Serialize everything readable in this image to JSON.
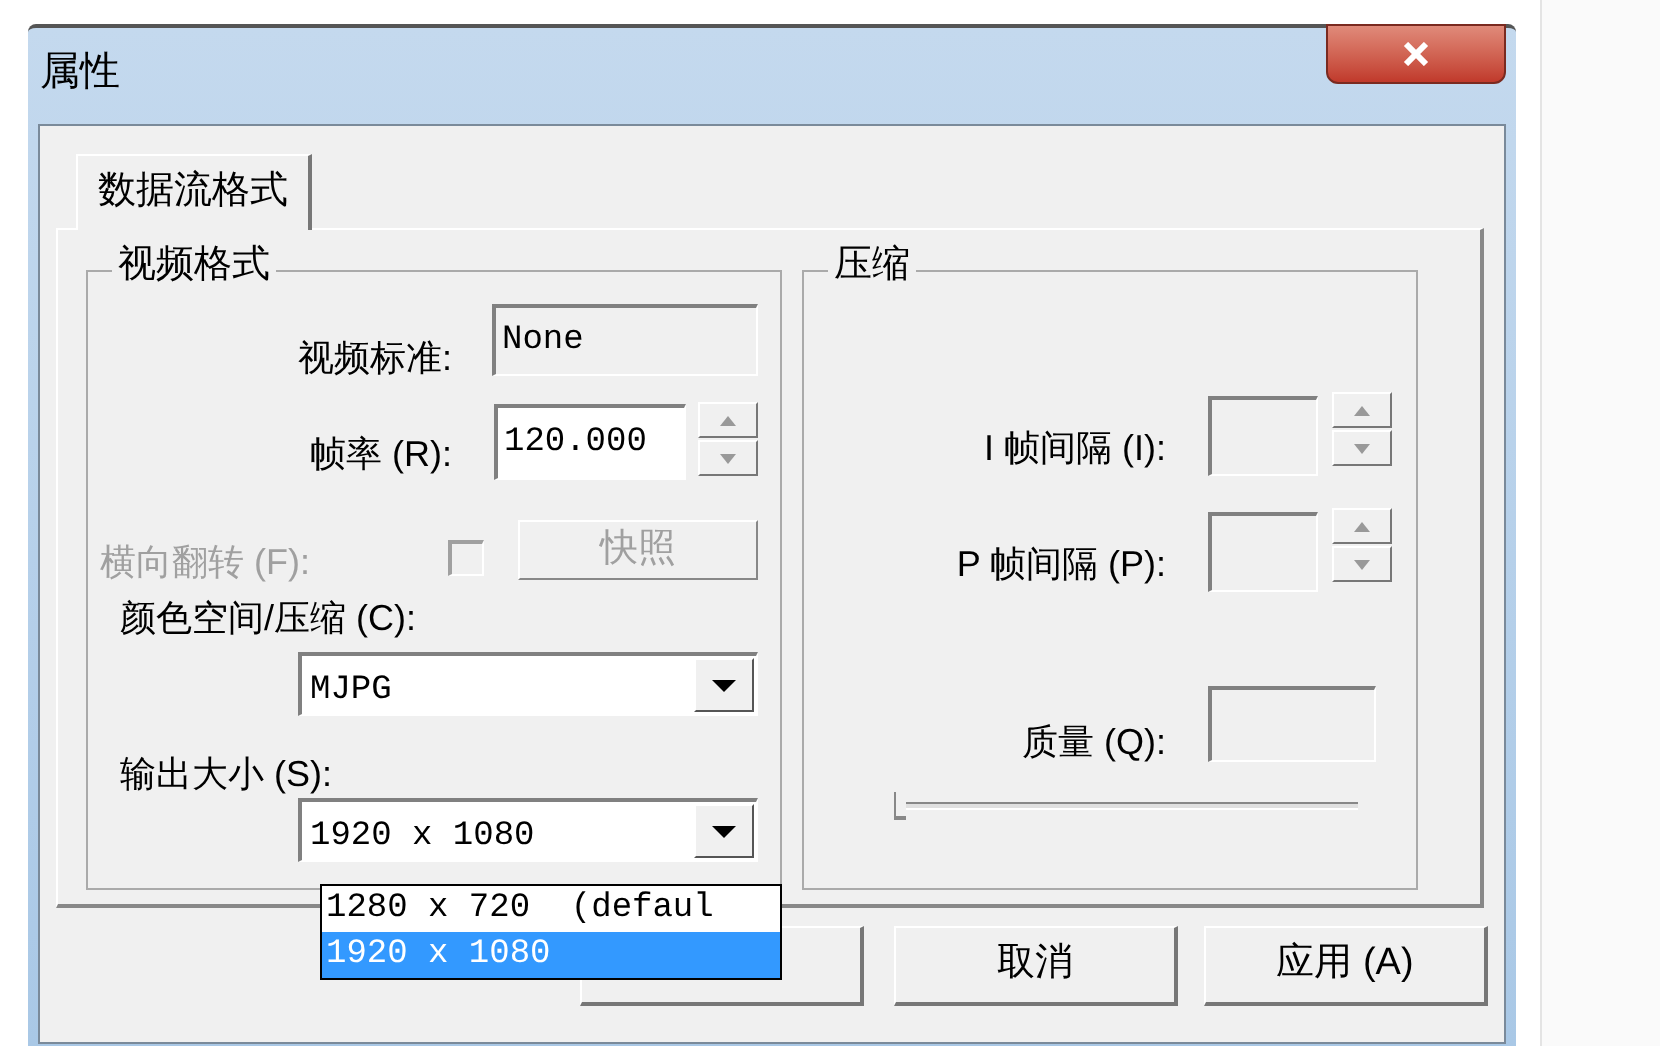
{
  "window": {
    "title": "属性"
  },
  "tabs": [
    {
      "label": "数据流格式",
      "selected": true
    }
  ],
  "video_format": {
    "title": "视频格式",
    "video_standard": {
      "label": "视频标准:",
      "value": "None",
      "disabled": true
    },
    "frame_rate": {
      "label": "帧率 (R):",
      "value": "120.000"
    },
    "flip_horizontal": {
      "label": "横向翻转 (F):",
      "checked": false,
      "disabled": true
    },
    "snapshot_button": {
      "label": "快照",
      "disabled": true
    },
    "color_space": {
      "label": "颜色空间/压缩 (C):",
      "value": "MJPG"
    },
    "output_size": {
      "label": "输出大小 (S):",
      "value": "1920 x 1080",
      "expanded": true,
      "options": [
        {
          "label": "1280 x 720  (defaul",
          "selected": false
        },
        {
          "label": "1920 x 1080",
          "selected": true
        }
      ]
    }
  },
  "compression": {
    "title": "压缩",
    "i_frame_interval": {
      "label": "I 帧间隔 (I):",
      "disabled": true
    },
    "p_frame_interval": {
      "label": "P 帧间隔 (P):",
      "disabled": true
    },
    "quality": {
      "label": "质量 (Q):",
      "disabled": true,
      "level": 0
    }
  },
  "buttons": [
    {
      "kind": "ok"
    },
    {
      "kind": "cancel",
      "label": "取消"
    },
    {
      "kind": "apply",
      "label": "应用 (A)"
    }
  ]
}
